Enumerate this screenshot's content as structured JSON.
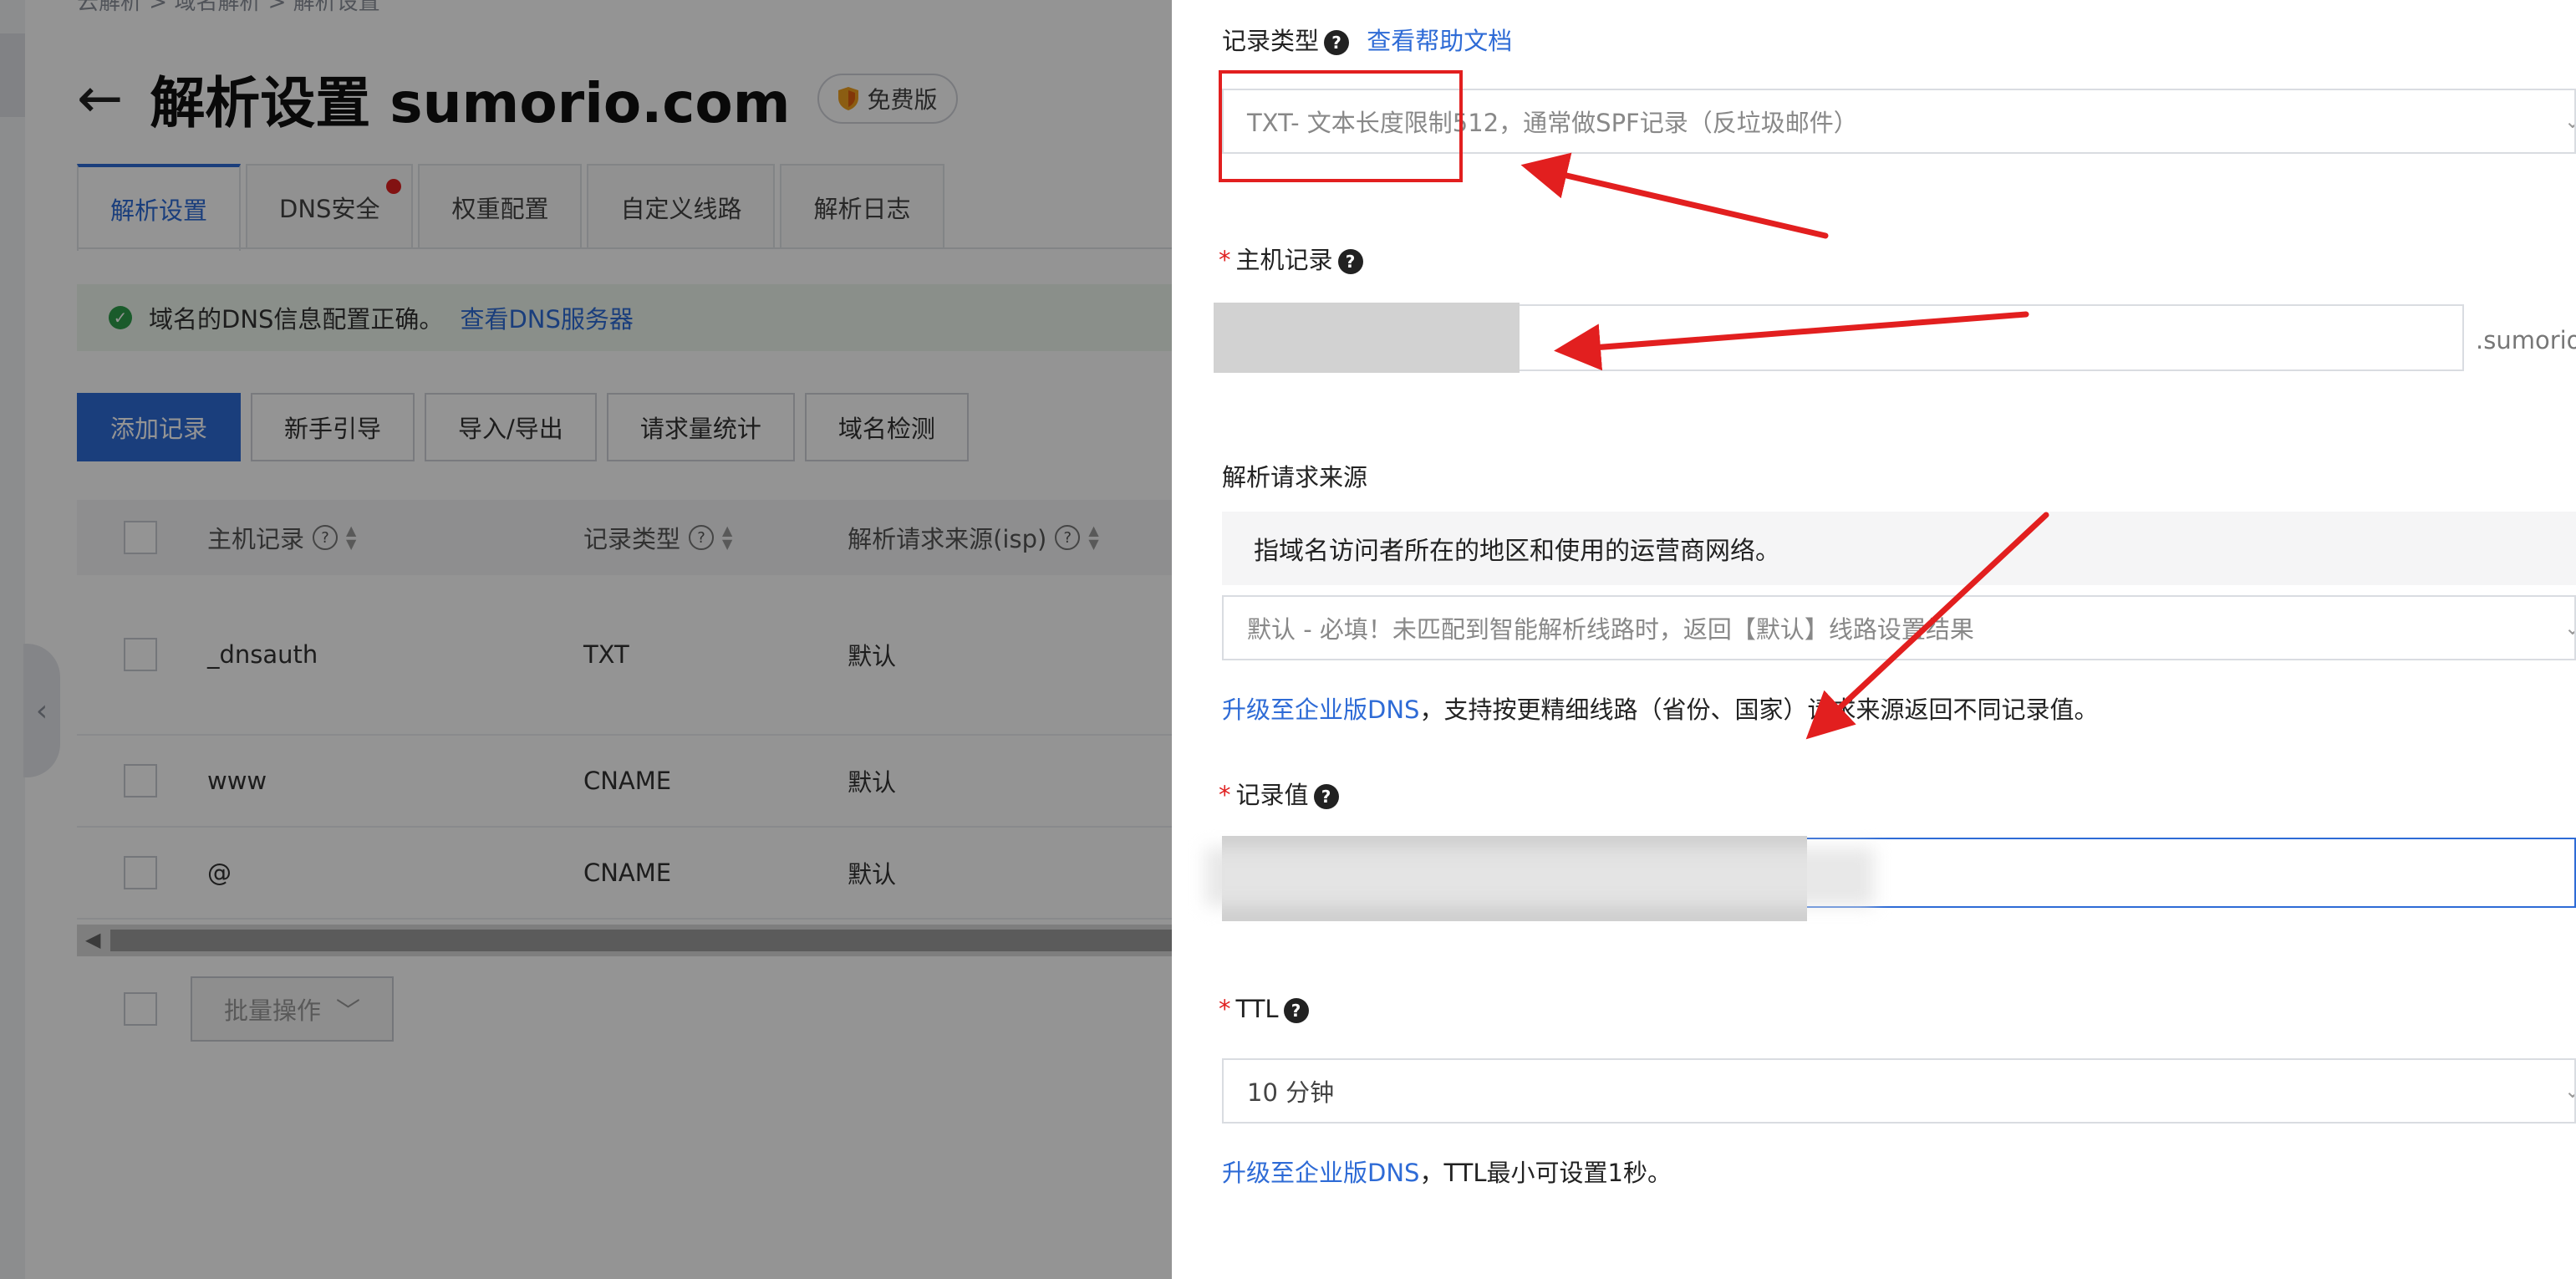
{
  "breadcrumb": "云解析  >  域名解析  >  解析设置",
  "page": {
    "title": "解析设置 sumorio.com",
    "badge": "免费版"
  },
  "tabs": [
    {
      "label": "解析设置",
      "active": true
    },
    {
      "label": "DNS安全",
      "has_dot": true
    },
    {
      "label": "权重配置"
    },
    {
      "label": "自定义线路"
    },
    {
      "label": "解析日志"
    }
  ],
  "notice": {
    "text": "域名的DNS信息配置正确。",
    "link": "查看DNS服务器"
  },
  "actions": [
    "添加记录",
    "新手引导",
    "导入/导出",
    "请求量统计",
    "域名检测"
  ],
  "table": {
    "headers": [
      "主机记录",
      "记录类型",
      "解析请求来源(isp)"
    ],
    "rows": [
      {
        "host": "_dnsauth",
        "type": "TXT",
        "line": "默认"
      },
      {
        "host": "www",
        "type": "CNAME",
        "line": "默认"
      },
      {
        "host": "@",
        "type": "CNAME",
        "line": "默认"
      }
    ]
  },
  "batch_label": "批量操作",
  "drawer": {
    "record_type": {
      "label": "记录类型",
      "help_link": "查看帮助文档",
      "value": "TXT- 文本长度限制512，通常做SPF记录（反垃圾邮件）"
    },
    "host": {
      "label": "主机记录",
      "suffix": ".sumorio."
    },
    "line": {
      "label": "解析请求来源",
      "hint": "指域名访问者所在的地区和使用的运营商网络。",
      "value": "默认 - 必填！未匹配到智能解析线路时，返回【默认】线路设置结果",
      "upgrade_link": "升级至企业版DNS",
      "upgrade_text": "，支持按更精细线路（省份、国家）请求来源返回不同记录值。"
    },
    "value": {
      "label": "记录值"
    },
    "ttl": {
      "label": "TTL",
      "value": "10 分钟",
      "upgrade_link": "升级至企业版DNS",
      "upgrade_text": "，TTL最小可设置1秒。"
    }
  },
  "colors": {
    "accent": "#2e6bd6",
    "annotation_red": "#e21f1f",
    "success": "#2e9d4a"
  }
}
